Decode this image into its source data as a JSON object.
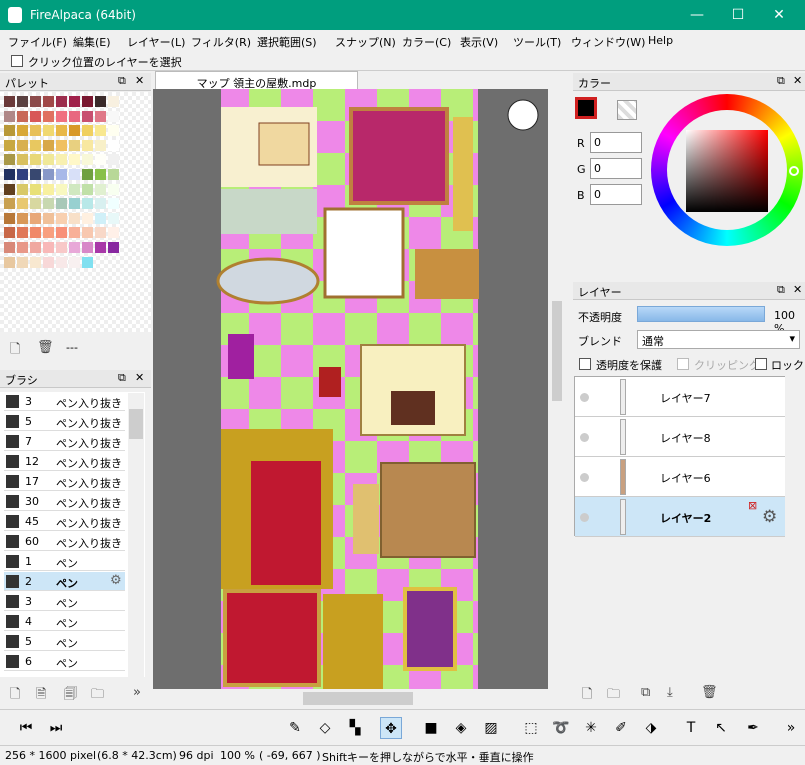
{
  "titlebar": {
    "title": "FireAlpaca (64bit)",
    "minimize": "—",
    "maximize": "☐",
    "close": "✕"
  },
  "menu": [
    "ファイル(F)",
    "編集(E)",
    "レイヤー(L)",
    "フィルタ(R)",
    "選択範囲(S)",
    "スナップ(N)",
    "カラー(C)",
    "表示(V)",
    "ツール(T)",
    "ウィンドウ(W)",
    "Help"
  ],
  "options": {
    "select_layer_label": "クリック位置のレイヤーを選択"
  },
  "palette": {
    "title": "パレット",
    "footer_text": "---",
    "colors": [
      "#6b3a3a",
      "#5a4040",
      "#8b4a4a",
      "#a04848",
      "#9c2c4c",
      "#a0204a",
      "#7a1830",
      "#3a2a2a",
      "#f8f0e0",
      "#b08888",
      "#c86858",
      "#d85858",
      "#e07060",
      "#f07080",
      "#e86880",
      "#c85070",
      "#e07888",
      "#f8f8f8",
      "#b89838",
      "#d8a838",
      "#e8c058",
      "#f0d870",
      "#e8b848",
      "#d89828",
      "#f0d060",
      "#f8e890",
      "#fffff0",
      "#c8a840",
      "#d8b050",
      "#e8c860",
      "#d8a848",
      "#f0c060",
      "#e8d080",
      "#f8e8a0",
      "#f8f0c8",
      "#ffffff",
      "#a89848",
      "#d8c060",
      "#e8d878",
      "#f0e898",
      "#f8f0b0",
      "#fff8c8",
      "#f8f8d8",
      "#fffff8",
      "#f0f0f0",
      "#203060",
      "#304080",
      "#384870",
      "#8898c8",
      "#a8b8e8",
      "#d8e0f8",
      "#70a040",
      "#88c048",
      "#b8d898",
      "#604020",
      "#d8c868",
      "#e8e078",
      "#f8f0a0",
      "#f8f8c0",
      "#d0e8c0",
      "#c0e0a8",
      "#e0f0d0",
      "#f8fff0",
      "#c8a050",
      "#e8c870",
      "#d8d8a0",
      "#c8d8b0",
      "#a8c8b8",
      "#98d0d0",
      "#b8e8e8",
      "#d8f0f0",
      "#f0ffff",
      "#b87838",
      "#d89858",
      "#e8a878",
      "#f0c098",
      "#f8d0b0",
      "#f8e0c8",
      "#fff0e0",
      "#d0f0f8",
      "#e8f8f8",
      "#c86848",
      "#e07858",
      "#f08868",
      "#f8a080",
      "#f89078",
      "#f8b098",
      "#f8c8b0",
      "#f8d8c8",
      "#fff0e8",
      "#d88878",
      "#e89888",
      "#f0a8a0",
      "#f8b8b8",
      "#f8c8c8",
      "#e8a8d8",
      "#d888c8",
      "#a838a8",
      "#8828a0",
      "#e8c8a0",
      "#f0d8b8",
      "#f8e8d0",
      "#f8d8d8",
      "#f8e8e8",
      "#f8f0f0",
      "#80e0f0"
    ]
  },
  "brush": {
    "title": "ブラシ",
    "items": [
      {
        "size": "3",
        "name": "ペン入り抜き"
      },
      {
        "size": "5",
        "name": "ペン入り抜き"
      },
      {
        "size": "7",
        "name": "ペン入り抜き"
      },
      {
        "size": "12",
        "name": "ペン入り抜き"
      },
      {
        "size": "17",
        "name": "ペン入り抜き"
      },
      {
        "size": "30",
        "name": "ペン入り抜き"
      },
      {
        "size": "45",
        "name": "ペン入り抜き"
      },
      {
        "size": "60",
        "name": "ペン入り抜き"
      },
      {
        "size": "1",
        "name": "ペン"
      },
      {
        "size": "2",
        "name": "ペン"
      },
      {
        "size": "3",
        "name": "ペン"
      },
      {
        "size": "4",
        "name": "ペン"
      },
      {
        "size": "5",
        "name": "ペン"
      },
      {
        "size": "6",
        "name": "ペン"
      }
    ],
    "selected_index": 9
  },
  "document": {
    "tab": "マップ 領主の屋敷.mdp"
  },
  "color": {
    "title": "カラー",
    "r_label": "R",
    "g_label": "G",
    "b_label": "B",
    "r": "0",
    "g": "0",
    "b": "0",
    "primary": "#000000"
  },
  "layer": {
    "title": "レイヤー",
    "opacity_label": "不透明度",
    "opacity_value": "100 %",
    "opacity": 1.0,
    "blend_label": "ブレンド",
    "blend_value": "通常",
    "protect_label": "透明度を保護",
    "clipping_label": "クリッピング",
    "lock_label": "ロック",
    "items": [
      "レイヤー7",
      "レイヤー8",
      "レイヤー6",
      "レイヤー2"
    ],
    "selected_index": 3
  },
  "status": {
    "size": "256 * 1600 pixel",
    "cm": "(6.8 * 42.3cm)",
    "dpi": "96 dpi",
    "zoom": "100 %",
    "coords": "( -69, 667 )",
    "hint": "Shiftキーを押しながらで水平・垂直に操作"
  }
}
